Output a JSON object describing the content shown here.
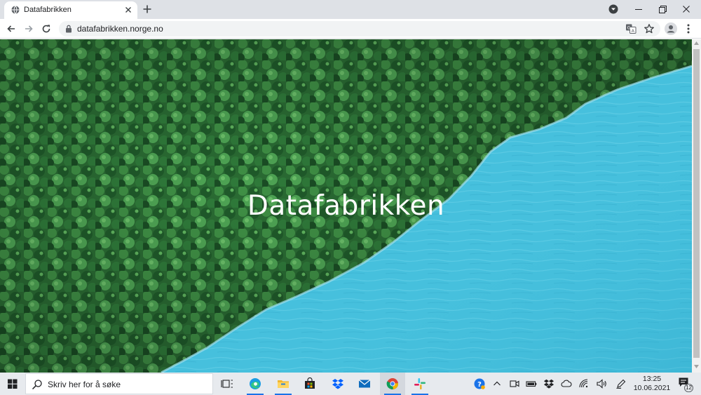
{
  "browser": {
    "tab": {
      "title": "Datafabrikken",
      "favicon": "globe-icon"
    },
    "address_bar": {
      "url": "datafabrikken.norge.no"
    },
    "icons": [
      "globe-icon",
      "close-icon",
      "plus-icon",
      "tab-search-icon",
      "minimize-icon",
      "restore-icon",
      "window-close-icon",
      "back-arrow-icon",
      "forward-arrow-icon",
      "reload-icon",
      "lock-icon",
      "translate-icon",
      "star-icon",
      "profile-icon",
      "menu-kebab-icon"
    ]
  },
  "page": {
    "hero_title": "Datafabrikken",
    "colors": {
      "forest": "#2f7a3a",
      "water": "#45bfdc",
      "title": "#ffffff"
    }
  },
  "taskbar": {
    "search_placeholder": "Skriv her for å søke",
    "pinned_apps": [
      "task-view-icon",
      "edge-icon",
      "file-explorer-icon",
      "store-icon",
      "dropbox-icon",
      "mail-icon",
      "chrome-icon",
      "slack-icon"
    ],
    "tray_icons": [
      "help-icon",
      "chevron-up-icon",
      "meet-icon",
      "battery-icon",
      "dropbox-tray-icon",
      "onedrive-icon",
      "wifi-icon",
      "volume-icon",
      "pen-icon"
    ],
    "clock": {
      "time": "13:25",
      "date": "10.06.2021"
    },
    "notifications": {
      "count": "12"
    }
  }
}
